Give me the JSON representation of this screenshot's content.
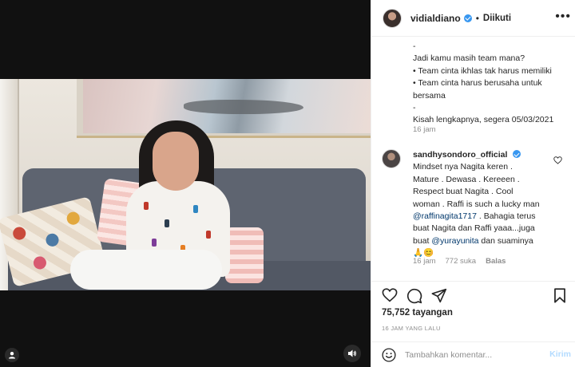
{
  "media": {
    "type": "video",
    "icons": {
      "tagged_users": "user-icon",
      "sound": "speaker-icon"
    }
  },
  "post": {
    "username": "vidialdiano",
    "verified": true,
    "separator": "•",
    "follow_status": "Diikuti",
    "more_icon": "more-dots-icon",
    "caption_lines": [
      "-",
      "Jadi kamu masih team mana?",
      "• Team cinta ikhlas tak harus memiliki",
      "• Team cinta harus berusaha untuk",
      "bersama",
      "-",
      "Kisah lengkapnya, segera 05/03/2021"
    ],
    "caption_time": "16 jam"
  },
  "comment": {
    "username": "sandhysondoro_official",
    "verified": true,
    "lines": [
      "Mindset nya Nagita keren .",
      "Mature . Dewasa . Kereeen .",
      "Respect buat Nagita . Cool",
      "woman . Raffi is such a lucky man"
    ],
    "mention1": "@raffinagita1717",
    "line5_rest": " . Bahagia terus",
    "line6": "buat Nagita dan Raffi yaaa...juga",
    "line7_prefix": "buat ",
    "mention2": "@yurayunita",
    "line7_rest": " dan suaminya",
    "emojis": "🙏😊",
    "time": "16 jam",
    "likes": "772 suka",
    "reply": "Balas",
    "heart_icon": "heart-outline-icon"
  },
  "actions": {
    "icons": [
      "heart-icon",
      "comment-icon",
      "share-icon",
      "bookmark-icon"
    ],
    "views": "75,752 tayangan",
    "posted": "16 JAM YANG LALU"
  },
  "input": {
    "emoji_icon": "emoji-icon",
    "placeholder": "Tambahkan komentar...",
    "send_label": "Kirim"
  },
  "colors": {
    "link": "#00376b",
    "verified": "#3897f0",
    "muted": "#8e8e8e",
    "send_disabled": "#b3dbff"
  }
}
